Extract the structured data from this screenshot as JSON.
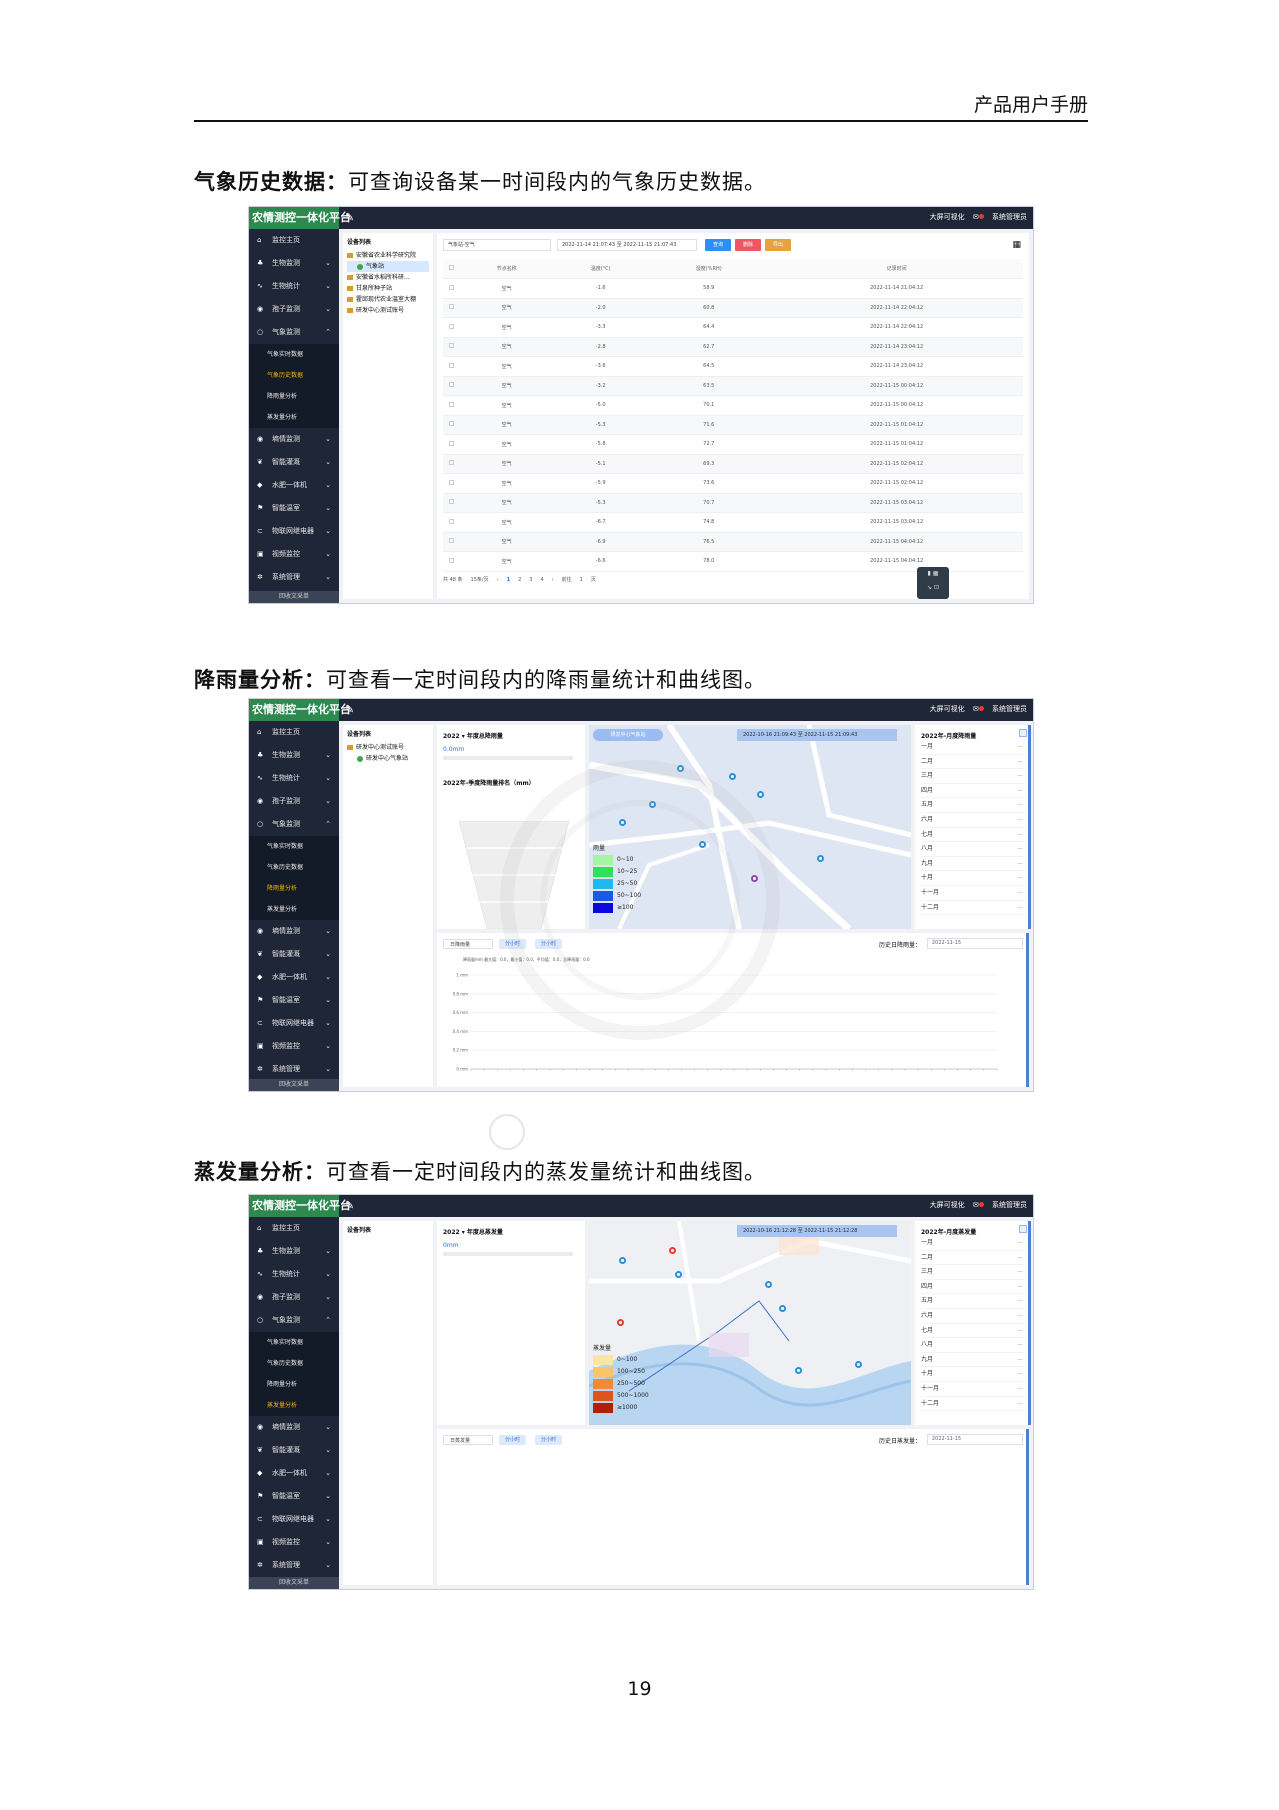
{
  "header": {
    "title": "产品用户手册"
  },
  "sections": [
    {
      "bold": "气象历史数据：",
      "text": "可查询设备某一时间段内的气象历史数据。"
    },
    {
      "bold": "降雨量分析：",
      "text": "可查看一定时间段内的降雨量统计和曲线图。"
    },
    {
      "bold": "蒸发量分析：",
      "text": "可查看一定时间段内的蒸发量统计和曲线图。"
    }
  ],
  "app": {
    "brand": "农情测控一体化平台",
    "topbar_right": [
      "大屏可视化",
      "系统管理员"
    ],
    "sidebar": {
      "items": [
        {
          "icon": "home-icon",
          "glyph": "⌂",
          "label": "监控主页"
        },
        {
          "icon": "leaf-icon",
          "glyph": "♣",
          "label": "生物监测"
        },
        {
          "icon": "chart-icon",
          "glyph": "∿",
          "label": "生物统计"
        },
        {
          "icon": "spore-icon",
          "glyph": "◉",
          "label": "孢子监测"
        },
        {
          "icon": "weather-icon",
          "glyph": "○",
          "label": "气象监测"
        }
      ],
      "subs": [
        "气象实时数据",
        "气象历史数据",
        "降雨量分析",
        "蒸发量分析"
      ],
      "items2": [
        {
          "icon": "soil-icon",
          "glyph": "◉",
          "label": "墒情监测"
        },
        {
          "icon": "irrigation-icon",
          "glyph": "❦",
          "label": "智能灌溉"
        },
        {
          "icon": "fertilizer-icon",
          "glyph": "◆",
          "label": "水肥一体机"
        },
        {
          "icon": "flag-icon",
          "glyph": "⚑",
          "label": "智能温室"
        },
        {
          "icon": "iot-icon",
          "glyph": "⊂",
          "label": "物联网继电器"
        },
        {
          "icon": "video-icon",
          "glyph": "▣",
          "label": "视频监控"
        },
        {
          "icon": "gear-icon",
          "glyph": "✲",
          "label": "系统管理"
        }
      ],
      "footer": "回收文采单"
    }
  },
  "shot1": {
    "tree_header": "设备列表",
    "tree": [
      {
        "type": "folder",
        "label": "安徽省农业科学研究院",
        "sel": false
      },
      {
        "type": "dot",
        "label": "气象站",
        "sel": true
      },
      {
        "type": "folder",
        "label": "安徽省水稻所科研...",
        "sel": false
      },
      {
        "type": "folder",
        "label": "甘泉所种子站",
        "sel": false
      },
      {
        "type": "folder",
        "label": "霍邱现代农业温室大棚",
        "sel": false
      },
      {
        "type": "folder",
        "label": "研发中心测试账号",
        "sel": false
      }
    ],
    "select_value": "气象站-空气",
    "date_range": "2022-11-14 21:07:43 至 2022-11-15 21:07:43",
    "buttons": [
      {
        "label": "查询",
        "color": "#2f8ef5"
      },
      {
        "label": "删除",
        "color": "#f05662"
      },
      {
        "label": "导出",
        "color": "#e6a23c"
      }
    ],
    "columns": [
      "节点名称",
      "温度(℃)",
      "湿度(%RH)",
      "记录时间"
    ],
    "rows": [
      [
        "空气",
        "-1.6",
        "58.9",
        "2022-11-14 21:04:12"
      ],
      [
        "空气",
        "-2.0",
        "60.8",
        "2022-11-14 22:04:12"
      ],
      [
        "空气",
        "-3.3",
        "64.4",
        "2022-11-14 22:04:12"
      ],
      [
        "空气",
        "-2.8",
        "62.7",
        "2022-11-14 23:04:12"
      ],
      [
        "空气",
        "-3.6",
        "64.5",
        "2022-11-14 23:04:12"
      ],
      [
        "空气",
        "-3.2",
        "63.5",
        "2022-11-15 00:04:12"
      ],
      [
        "空气",
        "-5.0",
        "70.1",
        "2022-11-15 00:04:12"
      ],
      [
        "空气",
        "-5.3",
        "71.6",
        "2022-11-15 01:04:12"
      ],
      [
        "空气",
        "-5.8",
        "72.7",
        "2022-11-15 01:04:12"
      ],
      [
        "空气",
        "-5.1",
        "69.3",
        "2022-11-15 02:04:12"
      ],
      [
        "空气",
        "-5.9",
        "73.6",
        "2022-11-15 02:04:12"
      ],
      [
        "空气",
        "-5.3",
        "70.7",
        "2022-11-15 03:04:12"
      ],
      [
        "空气",
        "-6.7",
        "74.8",
        "2022-11-15 03:04:12"
      ],
      [
        "空气",
        "-6.9",
        "76.5",
        "2022-11-15 04:04:12"
      ],
      [
        "空气",
        "-6.6",
        "78.0",
        "2022-11-15 04:04:12"
      ]
    ],
    "pager": [
      "共 48 条",
      "15条/页",
      "‹",
      "1",
      "2",
      "3",
      "4",
      "›",
      "前往",
      "1",
      "页"
    ]
  },
  "shot2": {
    "tree_header": "设备列表",
    "tree": [
      {
        "type": "folder",
        "label": "研发中心测试账号",
        "sel": false
      },
      {
        "type": "dot",
        "label": "研发中心气象站",
        "sel": false
      }
    ],
    "annual_title": "2022 ▾ 年度总降雨量",
    "annual_value": "0.0mm",
    "rank_title": "2022年-季度降雨量排名（mm）",
    "map_toggle": "研发中心气象站",
    "map_date": "2022-10-16 21:09:43 至 2022-11-15 21:09:43",
    "legend_title": "雨量",
    "legend": [
      {
        "label": "0~10",
        "color": "#a5f5a5"
      },
      {
        "label": "10~25",
        "color": "#2ee05a"
      },
      {
        "label": "25~50",
        "color": "#21b8f0"
      },
      {
        "label": "50~100",
        "color": "#1b58e8"
      },
      {
        "label": "≥100",
        "color": "#0a0ae0"
      }
    ],
    "months_title": "2022年-月度降雨量",
    "months": [
      "一月",
      "二月",
      "三月",
      "四月",
      "五月",
      "六月",
      "七月",
      "八月",
      "九月",
      "十月",
      "十一月",
      "十二月"
    ],
    "bottom": {
      "select": "日降雨量",
      "btn1": "分小时",
      "btn2": "分小时",
      "hist_label": "历史日降雨量：",
      "date": "2022-11-15",
      "stats": "降雨量mm    最大值：0.0，最小值：0.0，平均值：0.0，总降雨量：0.0"
    },
    "chart_data": {
      "type": "line",
      "ylabel": "",
      "ylim": [
        0,
        1
      ],
      "yticks": [
        "1 mm",
        "0.8 mm",
        "0.6 mm",
        "0.4 mm",
        "0.2 mm",
        "0 mm"
      ]
    }
  },
  "shot3": {
    "tree_header": "设备列表",
    "annual_title": "2022 ▾ 年度总蒸发量",
    "annual_value": "0mm",
    "map_date": "2022-10-16 21:12:28 至 2022-11-15 21:12:28",
    "legend_title": "蒸发量",
    "legend": [
      {
        "label": "0~100",
        "color": "#fbe6a0"
      },
      {
        "label": "100~250",
        "color": "#f7c46a"
      },
      {
        "label": "250~500",
        "color": "#f08a36"
      },
      {
        "label": "500~1000",
        "color": "#e0531e"
      },
      {
        "label": "≥1000",
        "color": "#b21e0a"
      }
    ],
    "months_title": "2022年-月度蒸发量",
    "months": [
      "一月",
      "二月",
      "三月",
      "四月",
      "五月",
      "六月",
      "七月",
      "八月",
      "九月",
      "十月",
      "十一月",
      "十二月"
    ],
    "bottom": {
      "select": "日蒸发量",
      "btn1": "分小时",
      "btn2": "分小时",
      "hist_label": "历史日蒸发量：",
      "date": "2022-11-15"
    }
  },
  "page_number": "19"
}
